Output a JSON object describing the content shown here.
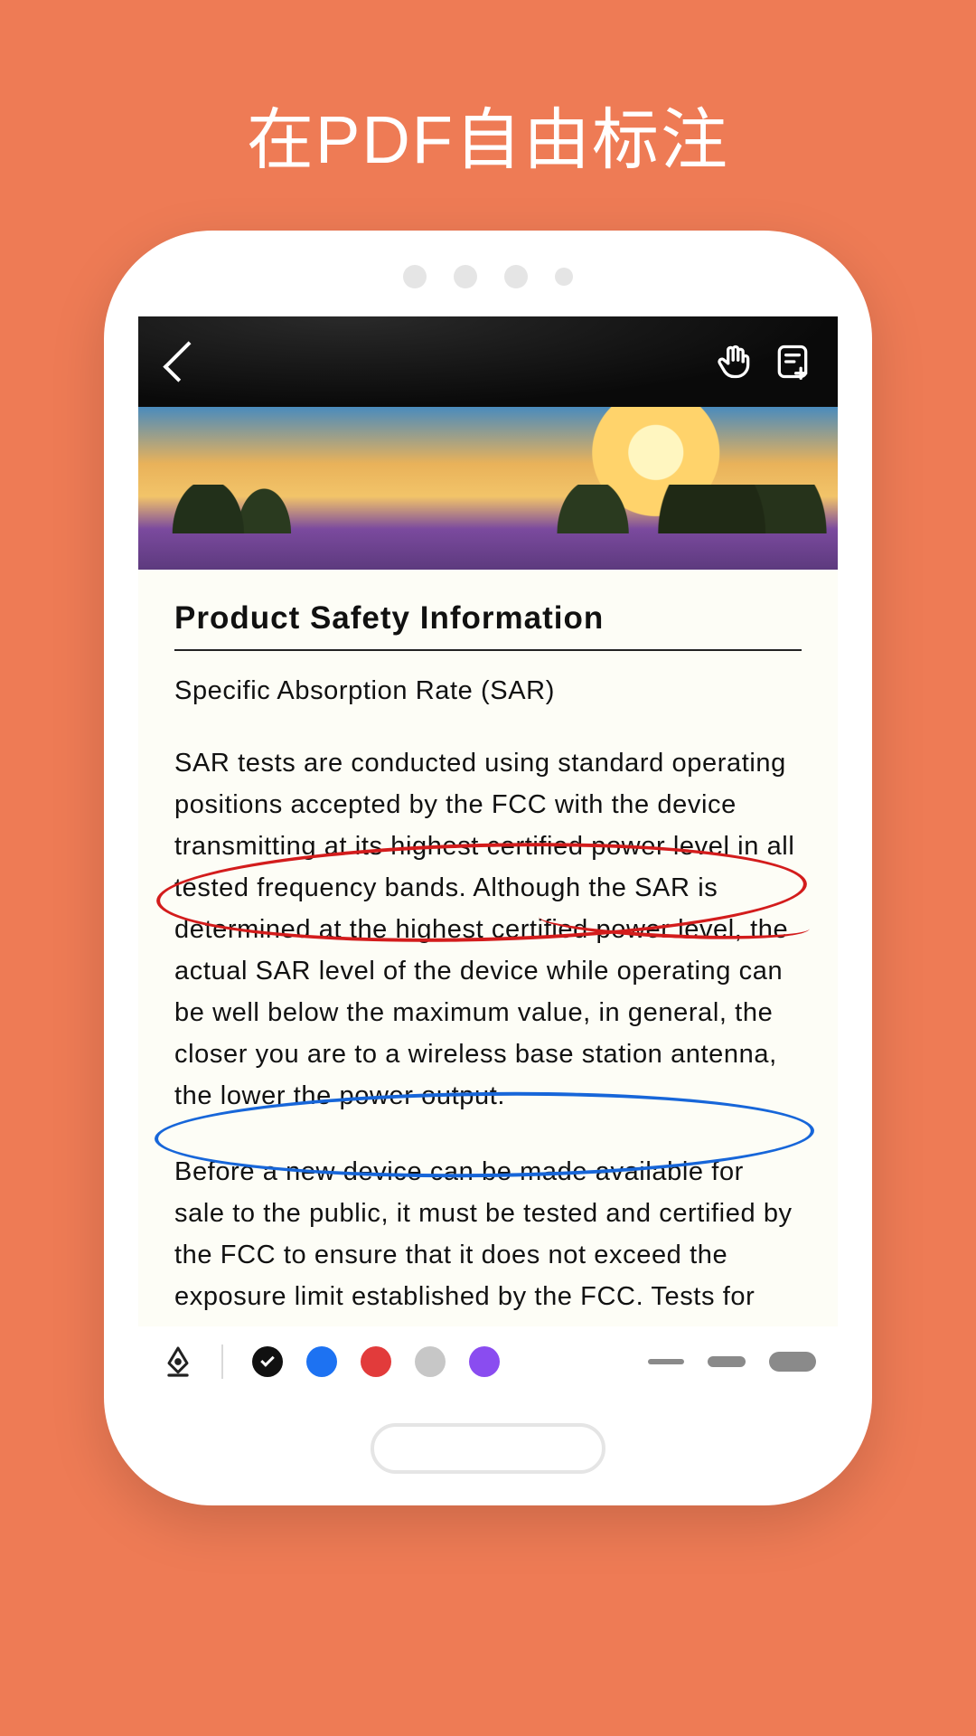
{
  "promo": {
    "title": "在PDF自由标注"
  },
  "header": {
    "back_icon": "back-chevron",
    "hand_icon": "hand-pointer-icon",
    "note_icon": "note-add-icon"
  },
  "document": {
    "title": "Product Safety Information",
    "subtitle": "Specific Absorption Rate (SAR)",
    "paragraph1": "SAR tests are conducted using standard operating positions accepted by the FCC with the device transmitting at its highest certified power level in all tested frequency bands. Although the SAR is determined at the highest certified power level, the actual SAR level of the device while operating can be well below the maximum value, in general, the closer you are to a wireless base station antenna, the lower the power output.",
    "paragraph2": "Before a new device can be made available for sale to the public, it must be tested and certified by the FCC to ensure that it does not exceed the exposure limit established by the FCC. Tests for each device are performed in positions and locations as required by the FCC."
  },
  "annotations": [
    {
      "type": "ellipse",
      "color": "#d31c1c",
      "target": "paragraph1-lines-4-5"
    },
    {
      "type": "ellipse",
      "color": "#1766d9",
      "target": "paragraph2-lines-2-3"
    }
  ],
  "toolbar": {
    "tool": "pen",
    "colors": [
      "black",
      "blue",
      "red",
      "gray",
      "purple"
    ],
    "selected_color": "black",
    "strokes": [
      "thin",
      "medium",
      "thick"
    ],
    "selected_stroke": "thin"
  }
}
